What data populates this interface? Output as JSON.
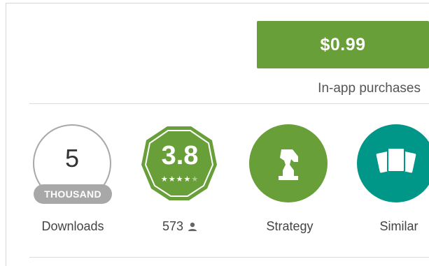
{
  "purchase": {
    "price_label": "$0.99",
    "iap_note": "In-app purchases"
  },
  "stats": {
    "downloads": {
      "number": "5",
      "unit": "THOUSAND",
      "label": "Downloads"
    },
    "rating": {
      "value": "3.8",
      "stars_filled": 4,
      "stars_total": 5,
      "count": "573"
    },
    "category": {
      "label": "Strategy",
      "icon": "chess-knight-icon"
    },
    "similar": {
      "label": "Similar",
      "icon": "cards-stack-icon"
    }
  },
  "colors": {
    "accent_green": "#689f38",
    "teal": "#009688",
    "badge_gray": "#a8a8a8"
  }
}
